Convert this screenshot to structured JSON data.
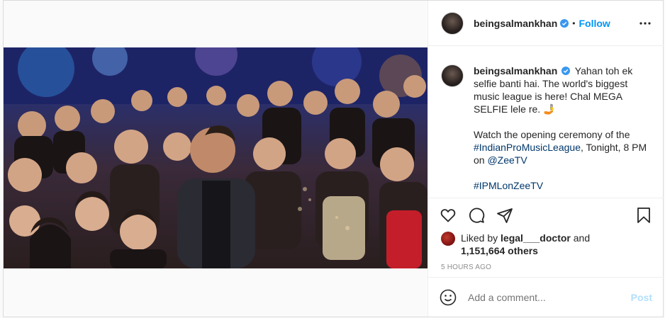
{
  "post": {
    "username": "beingsalmankhan",
    "follow_label": "Follow",
    "separator": "•"
  },
  "caption": {
    "username": "beingsalmankhan",
    "line1": "Yahan toh ek selfie banti hai. The world's biggest music league is here! Chal MEGA SELFIE lele re. 🤳",
    "line2_text": "Watch the opening ceremony of the",
    "hashtag1": "#IndianProMusicLeague",
    "line2_mid": ", Tonight, 8 PM on",
    "mention": "@ZeeTV",
    "hashtag2": "#IPMLonZeeTV"
  },
  "likes": {
    "prefix": "Liked by",
    "user": "legal___doctor",
    "and": "and",
    "count": "1,151,664 others"
  },
  "time_ago": "5 HOURS AGO",
  "comment": {
    "placeholder": "Add a comment...",
    "post_label": "Post"
  },
  "colors": {
    "accent": "#0095f6",
    "post_disabled": "#b2dffc",
    "link": "#00376b"
  },
  "icons": [
    "verified-icon",
    "more-options-icon",
    "heart-icon",
    "comment-icon",
    "share-icon",
    "bookmark-icon",
    "emoji-icon"
  ]
}
